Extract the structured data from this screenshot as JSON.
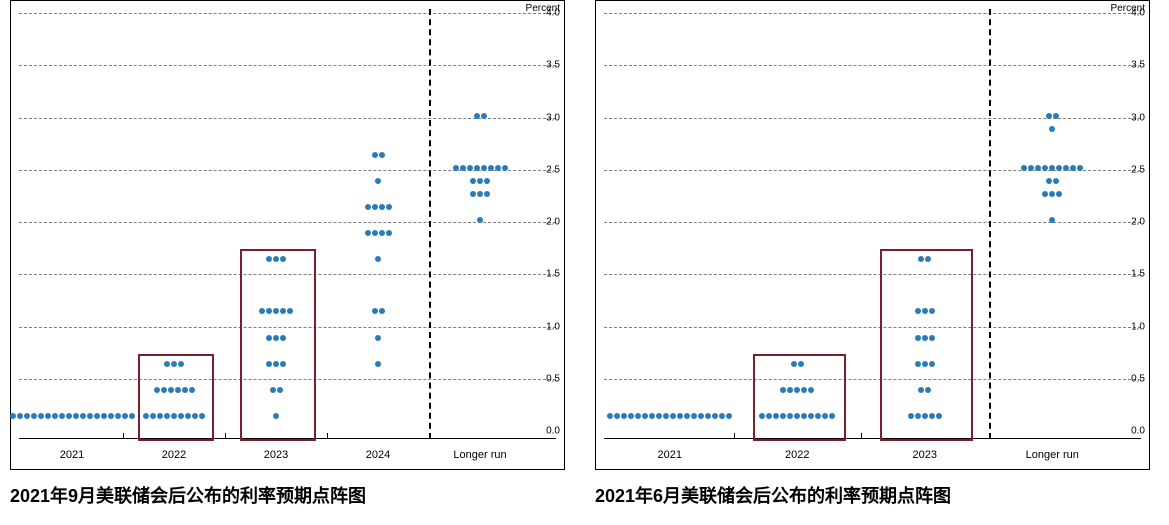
{
  "chart_data": [
    {
      "type": "scatter",
      "title": "2021年9月美联储会后公布的利率预期点阵图",
      "ylabel": "Percent",
      "ylim": [
        0,
        4.0
      ],
      "yticks": [
        0.0,
        0.5,
        1.0,
        1.5,
        2.0,
        2.5,
        3.0,
        3.5,
        4.0
      ],
      "categories": [
        "2021",
        "2022",
        "2023",
        "2024",
        "Longer run"
      ],
      "separator_after_index": 4,
      "highlights": [
        "2022",
        "2023"
      ],
      "series": [
        {
          "name": "2021",
          "value": 0.125,
          "count": 18
        },
        {
          "name": "2022",
          "value": 0.125,
          "count": 9
        },
        {
          "name": "2022",
          "value": 0.375,
          "count": 6
        },
        {
          "name": "2022",
          "value": 0.625,
          "count": 3
        },
        {
          "name": "2023",
          "value": 0.125,
          "count": 1
        },
        {
          "name": "2023",
          "value": 0.375,
          "count": 2
        },
        {
          "name": "2023",
          "value": 0.625,
          "count": 3
        },
        {
          "name": "2023",
          "value": 0.875,
          "count": 3
        },
        {
          "name": "2023",
          "value": 1.125,
          "count": 5
        },
        {
          "name": "2023",
          "value": 1.625,
          "count": 3
        },
        {
          "name": "2024",
          "value": 0.625,
          "count": 1
        },
        {
          "name": "2024",
          "value": 0.875,
          "count": 1
        },
        {
          "name": "2024",
          "value": 1.125,
          "count": 2
        },
        {
          "name": "2024",
          "value": 1.625,
          "count": 1
        },
        {
          "name": "2024",
          "value": 1.875,
          "count": 4
        },
        {
          "name": "2024",
          "value": 2.125,
          "count": 4
        },
        {
          "name": "2024",
          "value": 2.375,
          "count": 1
        },
        {
          "name": "2024",
          "value": 2.625,
          "count": 2
        },
        {
          "name": "Longer run",
          "value": 2.0,
          "count": 1
        },
        {
          "name": "Longer run",
          "value": 2.25,
          "count": 3
        },
        {
          "name": "Longer run",
          "value": 2.375,
          "count": 3
        },
        {
          "name": "Longer run",
          "value": 2.5,
          "count": 8
        },
        {
          "name": "Longer run",
          "value": 3.0,
          "count": 2
        }
      ]
    },
    {
      "type": "scatter",
      "title": "2021年6月美联储会后公布的利率预期点阵图",
      "ylabel": "Percent",
      "ylim": [
        0,
        4.0
      ],
      "yticks": [
        0.0,
        0.5,
        1.0,
        1.5,
        2.0,
        2.5,
        3.0,
        3.5,
        4.0
      ],
      "categories": [
        "2021",
        "2022",
        "2023",
        "Longer run"
      ],
      "separator_after_index": 3,
      "highlights": [
        "2022",
        "2023"
      ],
      "series": [
        {
          "name": "2021",
          "value": 0.125,
          "count": 18
        },
        {
          "name": "2022",
          "value": 0.125,
          "count": 11
        },
        {
          "name": "2022",
          "value": 0.375,
          "count": 5
        },
        {
          "name": "2022",
          "value": 0.625,
          "count": 2
        },
        {
          "name": "2023",
          "value": 0.125,
          "count": 5
        },
        {
          "name": "2023",
          "value": 0.375,
          "count": 2
        },
        {
          "name": "2023",
          "value": 0.625,
          "count": 3
        },
        {
          "name": "2023",
          "value": 0.875,
          "count": 3
        },
        {
          "name": "2023",
          "value": 1.125,
          "count": 3
        },
        {
          "name": "2023",
          "value": 1.625,
          "count": 2
        },
        {
          "name": "Longer run",
          "value": 2.0,
          "count": 1
        },
        {
          "name": "Longer run",
          "value": 2.25,
          "count": 3
        },
        {
          "name": "Longer run",
          "value": 2.375,
          "count": 2
        },
        {
          "name": "Longer run",
          "value": 2.5,
          "count": 9
        },
        {
          "name": "Longer run",
          "value": 2.875,
          "count": 1
        },
        {
          "name": "Longer run",
          "value": 3.0,
          "count": 2
        }
      ]
    }
  ]
}
